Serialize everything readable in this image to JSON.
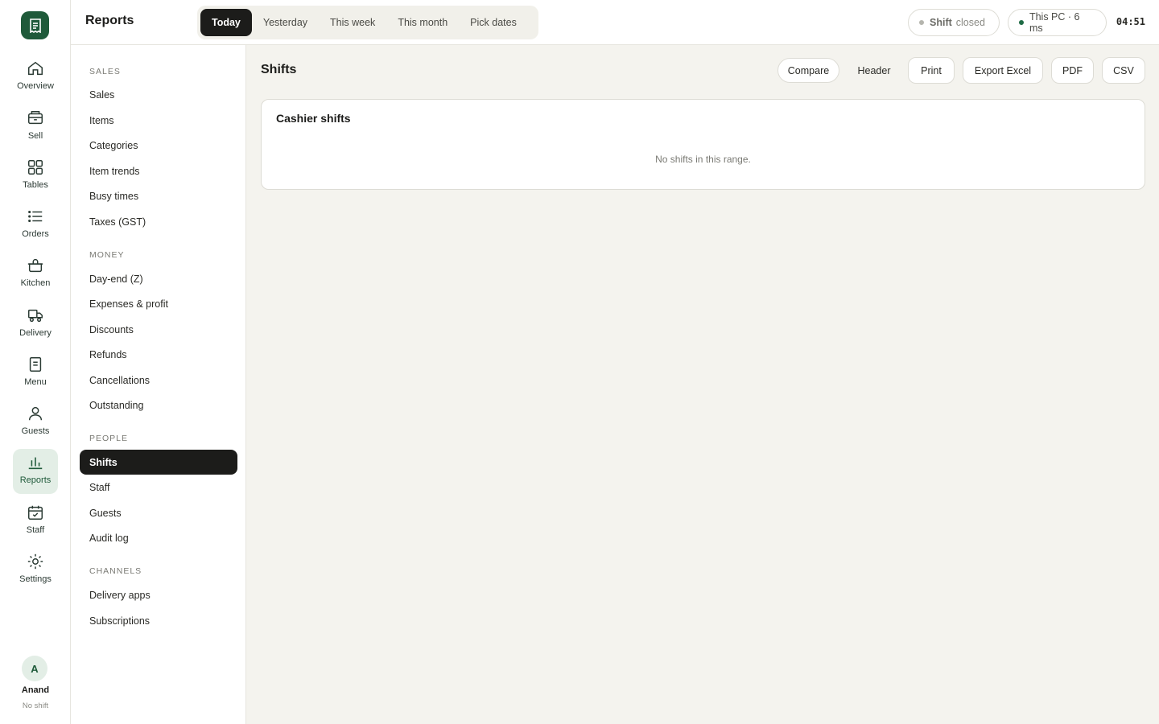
{
  "app": {
    "logo_icon": "receipt-icon",
    "brand_color": "#1f5a3a"
  },
  "rail": {
    "items": [
      {
        "label": "Overview",
        "icon": "home-icon"
      },
      {
        "label": "Sell",
        "icon": "register-icon"
      },
      {
        "label": "Tables",
        "icon": "grid-icon"
      },
      {
        "label": "Orders",
        "icon": "list-icon"
      },
      {
        "label": "Kitchen",
        "icon": "pot-icon"
      },
      {
        "label": "Delivery",
        "icon": "truck-icon"
      },
      {
        "label": "Menu",
        "icon": "document-icon"
      },
      {
        "label": "Guests",
        "icon": "person-icon"
      },
      {
        "label": "Reports",
        "icon": "bar-chart-icon",
        "active": true
      },
      {
        "label": "Staff",
        "icon": "calendar-check-icon"
      },
      {
        "label": "Settings",
        "icon": "sun-gear-icon"
      }
    ],
    "user": {
      "initial": "A",
      "name": "Anand",
      "status": "No shift"
    }
  },
  "topbar": {
    "title": "Reports",
    "ranges": [
      "Today",
      "Yesterday",
      "This week",
      "This month",
      "Pick dates"
    ],
    "active_range": "Today",
    "shift_label": "Shift",
    "shift_state": "closed",
    "device": "This PC · 6 ms",
    "clock": "04:51"
  },
  "subnav": {
    "sections": [
      {
        "heading": "SALES",
        "items": [
          "Sales",
          "Items",
          "Categories",
          "Item trends",
          "Busy times",
          "Taxes (GST)"
        ]
      },
      {
        "heading": "MONEY",
        "items": [
          "Day-end (Z)",
          "Expenses & profit",
          "Discounts",
          "Refunds",
          "Cancellations",
          "Outstanding"
        ]
      },
      {
        "heading": "PEOPLE",
        "items": [
          "Shifts",
          "Staff",
          "Guests",
          "Audit log"
        ]
      },
      {
        "heading": "CHANNELS",
        "items": [
          "Delivery apps",
          "Subscriptions"
        ]
      }
    ],
    "active": "Shifts"
  },
  "main": {
    "title": "Shifts",
    "actions": {
      "compare": "Compare",
      "header": "Header",
      "print": "Print",
      "export_excel": "Export Excel",
      "pdf": "PDF",
      "csv": "CSV"
    },
    "card": {
      "title": "Cashier shifts",
      "empty": "No shifts in this range."
    }
  },
  "colors": {
    "status_grey": "#b5b5ae",
    "status_green": "#1f6b45"
  }
}
